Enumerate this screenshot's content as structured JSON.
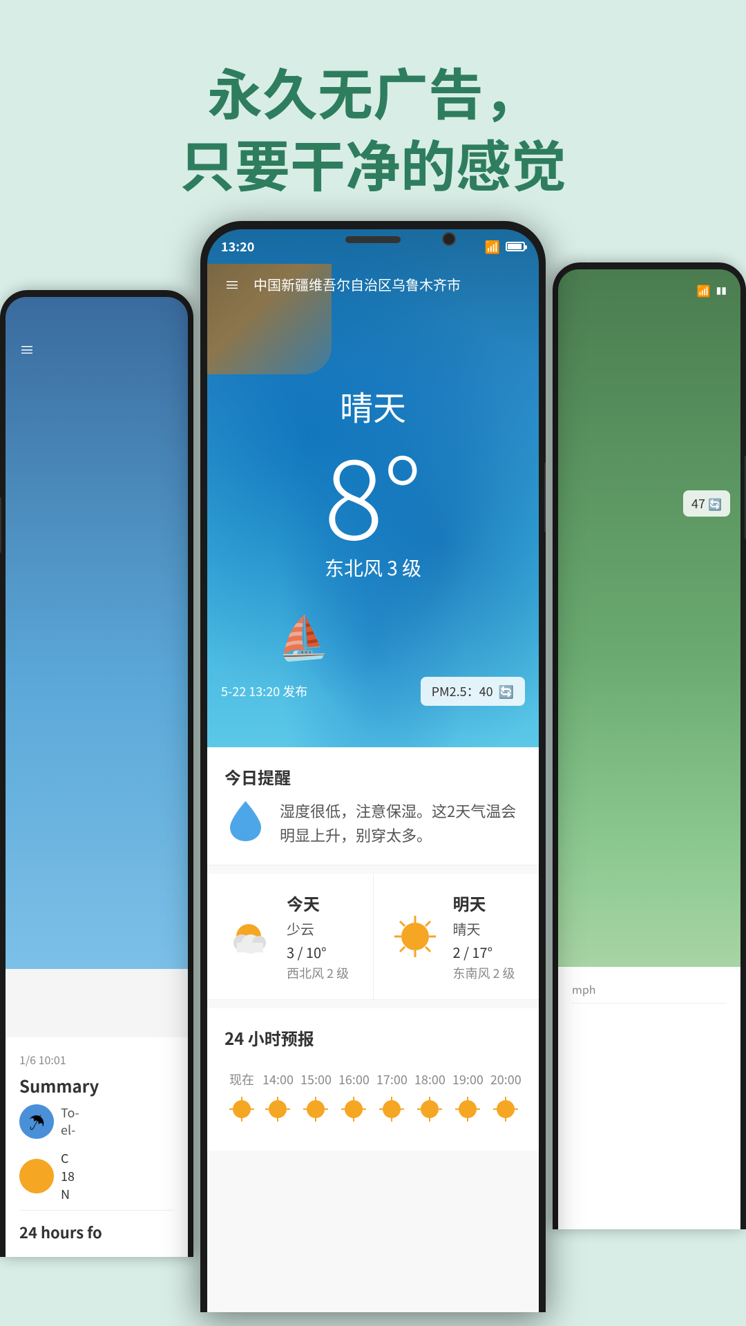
{
  "header": {
    "line1": "永久无广告，",
    "line2": "只要干净的感觉"
  },
  "mainPhone": {
    "statusBar": {
      "time": "13:20",
      "wifi": "WiFi",
      "battery": "Battery"
    },
    "nav": {
      "menuIcon": "≡",
      "location": "中国新疆维吾尔自治区乌鲁木齐市"
    },
    "weather": {
      "condition": "晴天",
      "temperature": "8°",
      "wind": "东北风 3 级",
      "publishTime": "5-22 13:20 发布",
      "pm25Label": "PM2.5：40"
    },
    "reminder": {
      "title": "今日提醒",
      "text": "湿度很低，注意保湿。这2天气温会明显上升，别穿太多。"
    },
    "today": {
      "label": "今天",
      "condition": "少云",
      "tempRange": "3 / 10°",
      "wind": "西北风 2 级"
    },
    "tomorrow": {
      "label": "明天",
      "condition": "晴天",
      "tempRange": "2 / 17°",
      "wind": "东南风 2 级"
    },
    "hourly": {
      "title": "24 小时预报",
      "times": [
        "现在",
        "14:00",
        "15:00",
        "16:00",
        "17:00",
        "18:00",
        "19:00",
        "20:00"
      ]
    }
  },
  "leftPhone": {
    "summary": "Summary",
    "date": "1/6 10:01",
    "item1": "To- el-",
    "todayLabel": "To",
    "todayText": "C\n18\nN",
    "hoursLabel": "24 hours fo"
  },
  "rightPhone": {
    "badge": "47"
  }
}
